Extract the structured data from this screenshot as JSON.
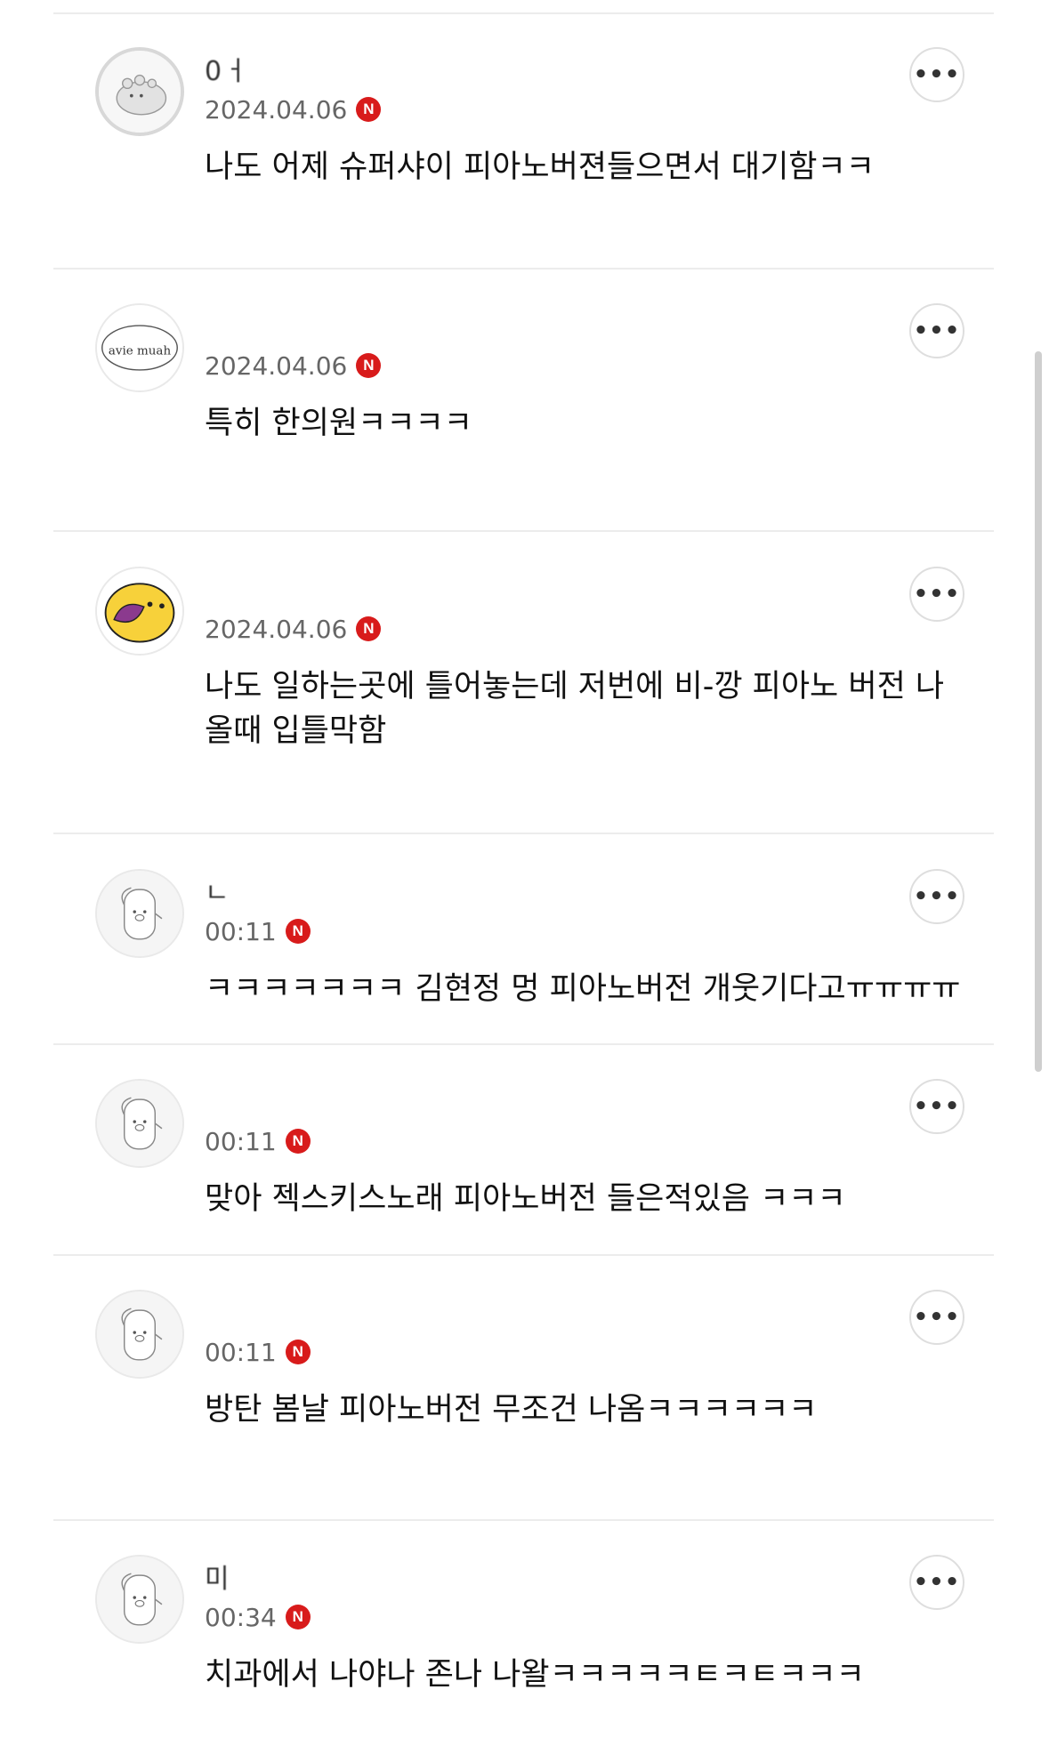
{
  "comments": [
    {
      "author": "0ㅓ",
      "avatar": "dinosaur-avatar",
      "date": "2024.04.06",
      "badge": "N",
      "text": "나도 어제 슈퍼샤이 피아노버젼들으면서 대기함ㅋㅋ",
      "more": "•••"
    },
    {
      "author": "",
      "avatar": "avie-muah-logo-avatar",
      "avatar_text": "avie muah",
      "date": "2024.04.06",
      "badge": "N",
      "text": "특히 한의원ㅋㅋㅋㅋ",
      "more": "•••"
    },
    {
      "author": "",
      "avatar": "yellow-character-avatar",
      "date": "2024.04.06",
      "badge": "N",
      "text": "나도 일하는곳에 틀어놓는데 저번에 비-깡 피아노 버전 나올때 입틀막함",
      "more": "•••"
    },
    {
      "author": "ㄴ",
      "avatar": "default-pig-avatar",
      "date": "00:11",
      "badge": "N",
      "text": "ㅋㅋㅋㅋㅋㅋㅋ 김현정 멍 피아노버전 개웃기다고ㅠㅠㅠㅠ",
      "more": "•••"
    },
    {
      "author": "",
      "avatar": "default-pig-avatar",
      "date": "00:11",
      "badge": "N",
      "text": "맞아 젝스키스노래 피아노버전 들은적있음 ㅋㅋㅋ",
      "more": "•••"
    },
    {
      "author": "",
      "avatar": "default-pig-avatar",
      "date": "00:11",
      "badge": "N",
      "text": "방탄 봄날 피아노버전 무조건 나옴ㅋㅋㅋㅋㅋㅋ",
      "more": "•••"
    },
    {
      "author": "미",
      "avatar": "default-pig-avatar",
      "date": "00:34",
      "badge": "N",
      "text": "치과에서 나야나 존나 나왈ㅋㅋㅋㅋㅋㅌㅋㅌㅋㅋㅋ",
      "more": "•••"
    }
  ],
  "colors": {
    "badge": "#d81b1b",
    "date": "#666666",
    "divider": "#ececec"
  }
}
